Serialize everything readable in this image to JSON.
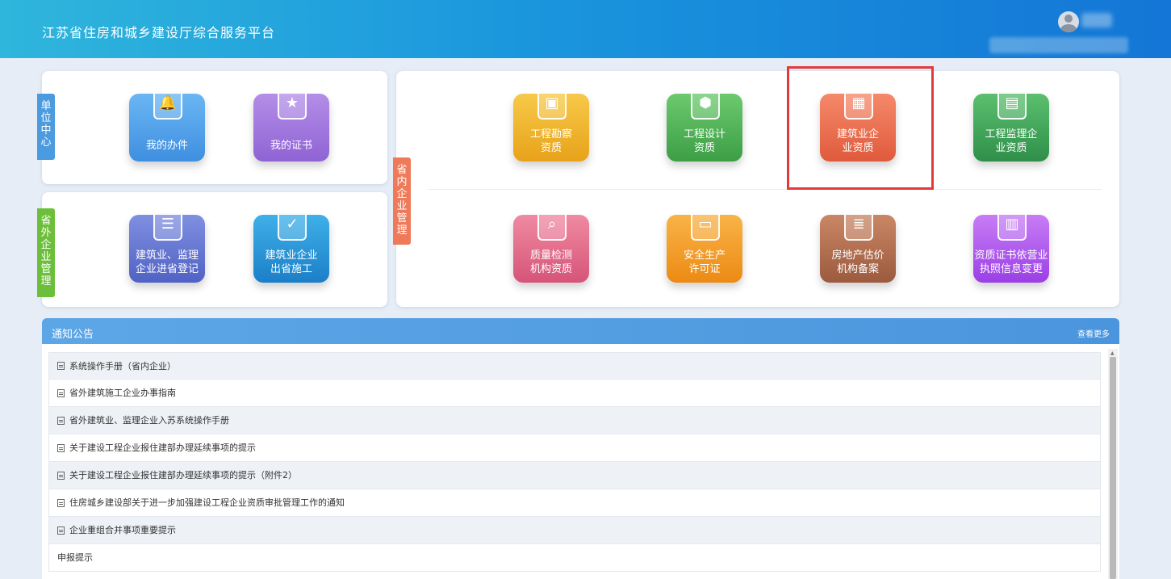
{
  "header": {
    "title": "江苏省住房和城乡建设厅综合服务平台"
  },
  "unit_center": {
    "tag": "单位中心",
    "tiles": [
      {
        "label": "我的办件",
        "icon": "bell-icon"
      },
      {
        "label": "我的证书",
        "icon": "medal-icon"
      }
    ]
  },
  "outside_mgmt": {
    "tag": "省外企业管理",
    "tiles": [
      {
        "label": "建筑业、监理企业进省登记",
        "icon": "clipboard-icon"
      },
      {
        "label": "建筑业企业出省施工",
        "icon": "calendar-shield-icon"
      }
    ]
  },
  "inside_mgmt": {
    "tag": "省内企业管理",
    "tiles": [
      {
        "label": "工程勘察资质",
        "icon": "folder-icon",
        "color": "#f0b429"
      },
      {
        "label": "工程设计资质",
        "icon": "hexagon-icon",
        "color": "#4caf50"
      },
      {
        "label": "建筑业企业资质",
        "icon": "building-icon",
        "color": "#ef6c4f"
      },
      {
        "label": "工程监理企业资质",
        "icon": "grid-icon",
        "color": "#3ca65a"
      },
      {
        "label": "质量检测机构资质",
        "icon": "magnifier-icon",
        "color": "#e0607e"
      },
      {
        "label": "安全生产许可证",
        "icon": "id-card-icon",
        "color": "#f39c12"
      },
      {
        "label": "房地产估价机构备案",
        "icon": "document-icon",
        "color": "#b06a4e"
      },
      {
        "label": "资质证书依营业执照信息变更",
        "icon": "calendar-chart-icon",
        "color": "#a855f7"
      }
    ]
  },
  "notice": {
    "title": "通知公告",
    "more": "查看更多",
    "items": [
      "系统操作手册（省内企业）",
      "省外建筑施工企业办事指南",
      "省外建筑业、监理企业入苏系统操作手册",
      "关于建设工程企业报住建部办理延续事项的提示",
      "关于建设工程企业报住建部办理延续事项的提示（附件2）",
      "住房城乡建设部关于进一步加强建设工程企业资质审批管理工作的通知",
      "企业重组合并事项重要提示",
      "申报提示"
    ]
  },
  "colors": {
    "header_start": "#2fb6dc",
    "header_end": "#1476d6",
    "highlight": "#e23a3a"
  }
}
